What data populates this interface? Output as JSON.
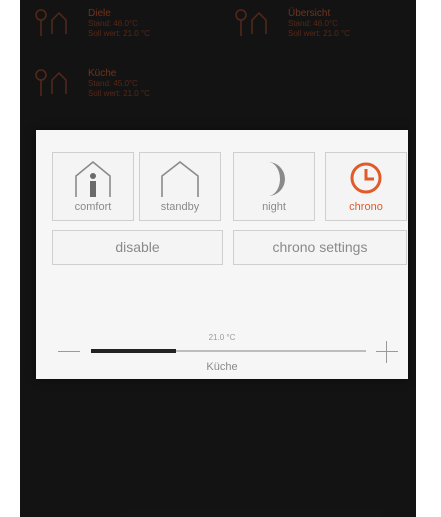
{
  "zones": [
    {
      "name": "Diele",
      "line1": "Stand: 46.0°C",
      "line2": "Soll wert: 21.0 °C"
    },
    {
      "name": "Übersicht",
      "line1": "Stand: 46.0°C",
      "line2": "Soll wert: 21.0 °C"
    },
    {
      "name": "Küche",
      "line1": "Stand: 45.0°C",
      "line2": "Soll wert: 21.0 °C"
    }
  ],
  "modes": [
    {
      "label": "comfort",
      "icon": "house-person-icon"
    },
    {
      "label": "standby",
      "icon": "house-outline-icon"
    },
    {
      "label": "night",
      "icon": "crescent-moon-icon"
    },
    {
      "label": "chrono",
      "icon": "clock-icon"
    }
  ],
  "buttons": {
    "disable": "disable",
    "chrono_settings": "chrono settings"
  },
  "slider": {
    "temperature": "21.0 °C",
    "room": "Küche",
    "fill_fraction": 0.31
  },
  "colors": {
    "accent": "#e05a2a",
    "zone_text": "#a04a2a",
    "panel_bg": "#f6f6f6",
    "screen_bg": "#1c1c1c"
  }
}
